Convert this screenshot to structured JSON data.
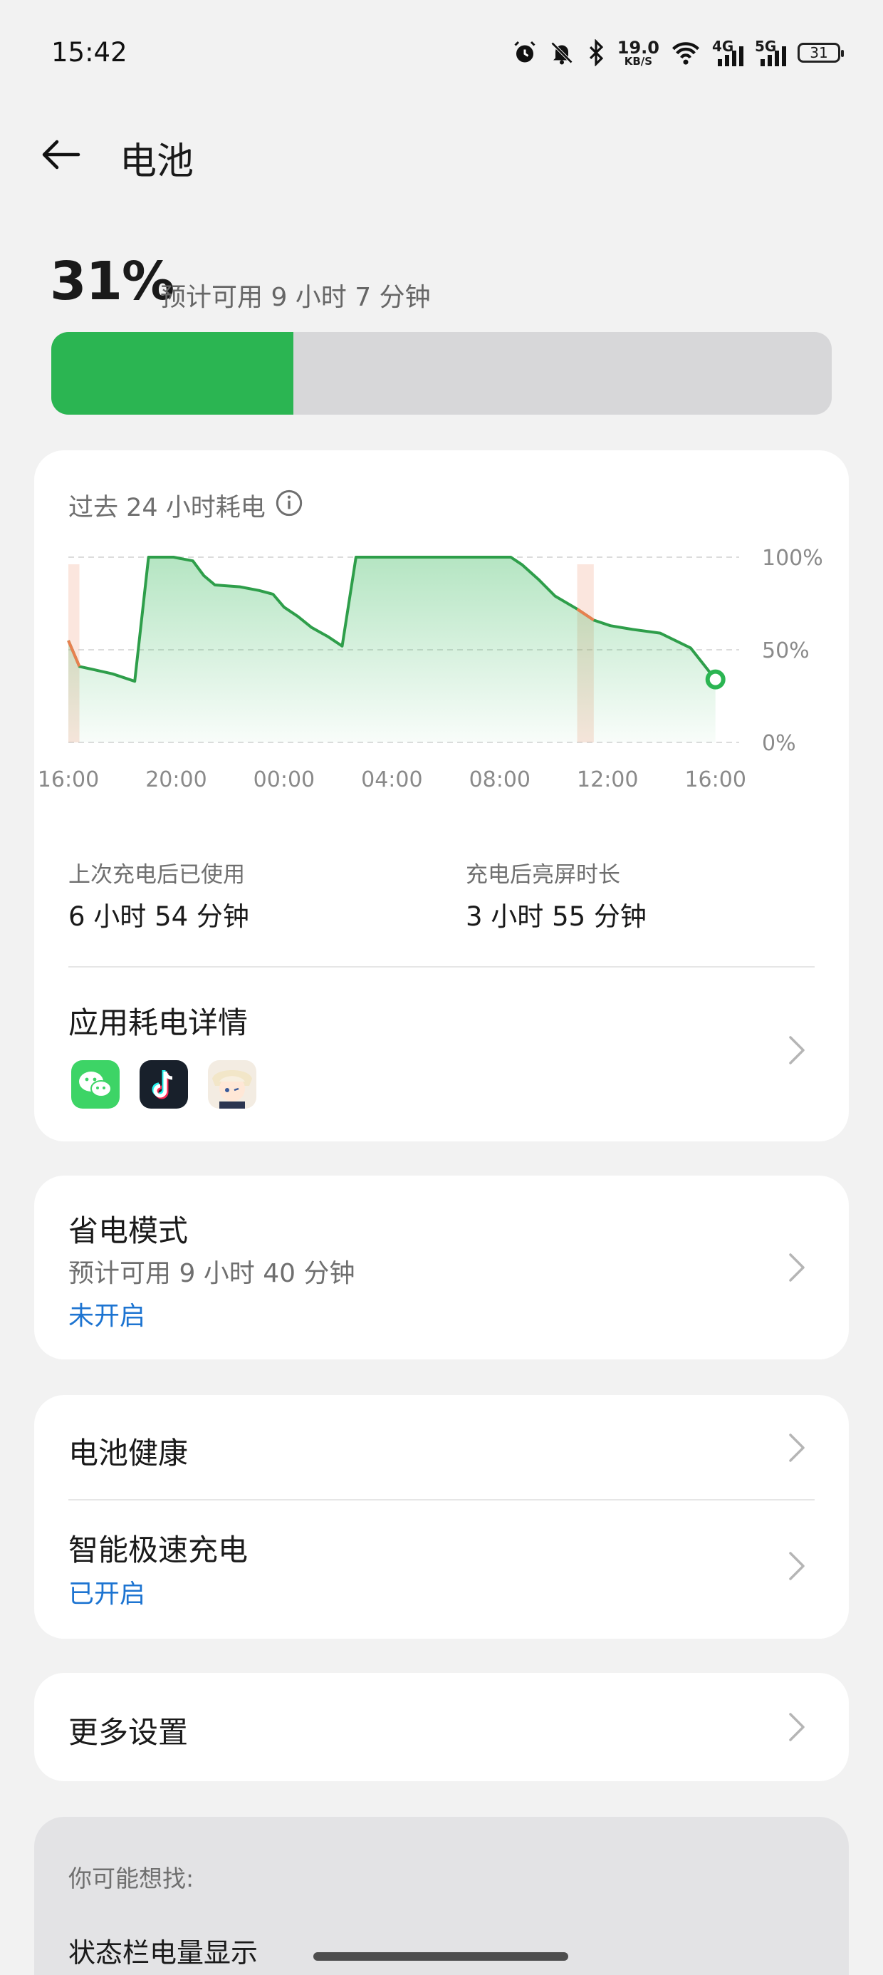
{
  "status_bar": {
    "time": "15:42",
    "net_speed_value": "19.0",
    "net_speed_unit": "KB/S",
    "net_4g": "4G",
    "net_5g": "5G",
    "battery_level": "31",
    "icons": [
      "alarm-icon",
      "mute-icon",
      "bluetooth-icon",
      "wifi-icon",
      "signal-icon",
      "signal-icon",
      "battery-icon"
    ]
  },
  "header": {
    "title": "电池",
    "back_icon": "arrow-left-icon"
  },
  "summary": {
    "percent_text": "31%",
    "percent_value": 31,
    "estimate": "预计可用 9 小时 7 分钟",
    "bar_color": "#2bb552"
  },
  "usage_card": {
    "title": "过去 24 小时耗电",
    "info_icon": "info-icon",
    "stats": [
      {
        "label": "上次充电后已使用",
        "value": "6 小时 54 分钟"
      },
      {
        "label": "充电后亮屏时长",
        "value": "3 小时 55 分钟"
      }
    ],
    "app_details": {
      "title": "应用耗电详情",
      "apps": [
        "wechat-app-icon",
        "tiktok-app-icon",
        "game-app-icon"
      ]
    }
  },
  "chart_data": {
    "type": "area",
    "x_tick_labels": [
      "16:00",
      "20:00",
      "00:00",
      "04:00",
      "08:00",
      "12:00",
      "16:00"
    ],
    "y_tick_labels": [
      "100%",
      "50%",
      "0%"
    ],
    "ylim": [
      0,
      100
    ],
    "grid": true,
    "x_hours": [
      0,
      0.4,
      1,
      1.6,
      2.4,
      2.9,
      3.8,
      4.5,
      4.9,
      5.3,
      6.2,
      6.9,
      7.4,
      7.8,
      8.3,
      8.8,
      9.4,
      9.9,
      10.4,
      11.0,
      11.9,
      12.1,
      12.7,
      13.8,
      15.0,
      16.0,
      16.4,
      17.0,
      17.6,
      18.4,
      19.0,
      19.6,
      20.4,
      21.4,
      22.5,
      23.4
    ],
    "battery_percent": [
      55,
      41,
      39,
      37,
      33,
      100,
      100,
      98,
      90,
      85,
      84,
      82,
      80,
      73,
      68,
      62,
      57,
      52,
      100,
      100,
      100,
      100,
      100,
      100,
      100,
      100,
      96,
      88,
      79,
      72,
      66,
      63,
      61,
      59,
      51,
      34
    ],
    "series_color": "#2e9e4a",
    "discharge_highlight_color": "#f0a58a",
    "highlight_ranges_hours": [
      [
        0,
        0.4
      ],
      [
        18.4,
        19.0
      ]
    ]
  },
  "power_saving": {
    "title": "省电模式",
    "estimate": "预计可用 9 小时 40 分钟",
    "status": "未开启"
  },
  "battery_group": {
    "health_title": "电池健康",
    "fast_charge_title": "智能极速充电",
    "fast_charge_status": "已开启"
  },
  "more_settings": {
    "title": "更多设置"
  },
  "suggestions": {
    "heading": "你可能想找:",
    "items": [
      "状态栏电量显示"
    ]
  }
}
